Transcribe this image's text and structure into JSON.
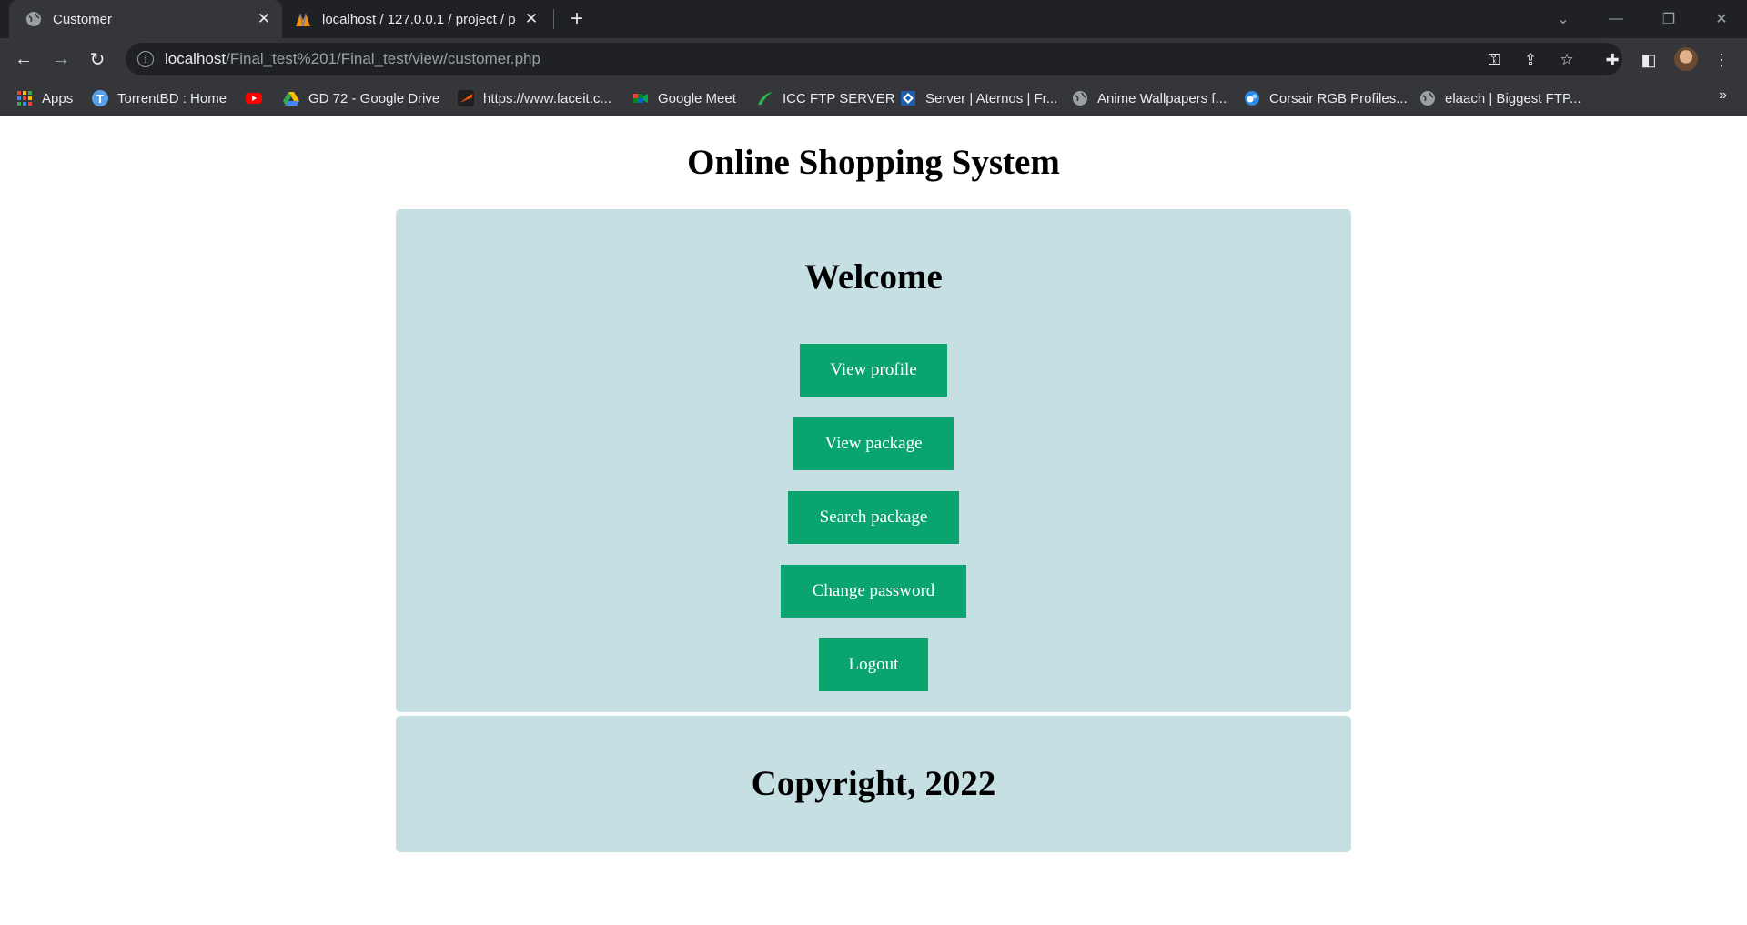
{
  "browser": {
    "tabs": [
      {
        "title": "Customer",
        "active": true
      },
      {
        "title": "localhost / 127.0.0.1 / project / p",
        "active": false
      }
    ],
    "url_host": "localhost",
    "url_path": "/Final_test%201/Final_test/view/customer.php",
    "bookmarks": [
      {
        "label": "Apps",
        "icon": "apps-grid-icon"
      },
      {
        "label": "TorrentBD : Home",
        "icon": "torrentbd-icon"
      },
      {
        "label": "",
        "icon": "youtube-icon"
      },
      {
        "label": "GD 72 - Google Drive",
        "icon": "google-drive-icon"
      },
      {
        "label": "https://www.faceit.c...",
        "icon": "faceit-icon"
      },
      {
        "label": "Google Meet",
        "icon": "google-meet-icon"
      },
      {
        "label": "ICC FTP SERVER",
        "icon": "icc-ftp-icon"
      },
      {
        "label": "Server | Aternos | Fr...",
        "icon": "aternos-icon"
      },
      {
        "label": "Anime Wallpapers f...",
        "icon": "globe-icon"
      },
      {
        "label": "Corsair RGB Profiles...",
        "icon": "corsair-icon"
      },
      {
        "label": "elaach | Biggest FTP...",
        "icon": "globe-icon"
      }
    ]
  },
  "page": {
    "title": "Online Shopping System",
    "welcome": "Welcome",
    "buttons": [
      {
        "label": "View profile"
      },
      {
        "label": "View package"
      },
      {
        "label": "Search package"
      },
      {
        "label": "Change password"
      },
      {
        "label": "Logout"
      }
    ],
    "copyright": "Copyright, 2022"
  },
  "colors": {
    "panel_bg": "#c5dfe3",
    "button_bg": "#0aa56f",
    "button_text": "#ffffff"
  }
}
